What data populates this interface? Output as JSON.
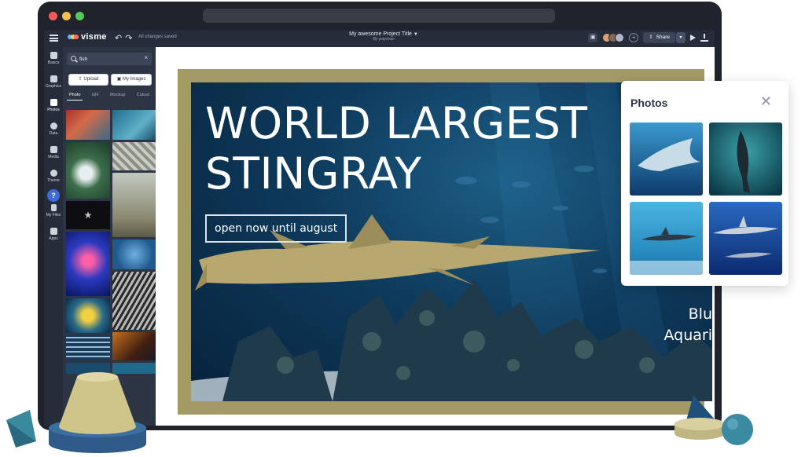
{
  "app": {
    "logo_text": "visme",
    "save_status": "All changes saved",
    "project_title": "My awesome Project Title",
    "project_byline": "By payman"
  },
  "topbar": {
    "share_label": "Share"
  },
  "rail": {
    "items": [
      {
        "label": "Basics",
        "icon": "shapes-icon"
      },
      {
        "label": "Graphics",
        "icon": "graphics-icon"
      },
      {
        "label": "Photos",
        "icon": "photo-icon"
      },
      {
        "label": "Data",
        "icon": "chart-icon"
      },
      {
        "label": "Media",
        "icon": "play-icon"
      },
      {
        "label": "Theme",
        "icon": "palette-icon"
      },
      {
        "label": "My Files",
        "icon": "file-icon"
      },
      {
        "label": "Apps",
        "icon": "apps-icon"
      }
    ],
    "help_label": "?"
  },
  "panel": {
    "search_value": "fish",
    "upload_label": "Upload",
    "my_images_label": "My Images",
    "tabs": [
      {
        "label": "Photo",
        "active": true
      },
      {
        "label": "GIF",
        "active": false
      },
      {
        "label": "Mockup",
        "active": false
      },
      {
        "label": "Cutout",
        "active": false
      }
    ]
  },
  "slide": {
    "headline_line1": "WORLD LARGEST",
    "headline_line2": "STINGRAY",
    "badge": "open now until august",
    "brand_line1": "Blu",
    "brand_line2": "Aquari"
  },
  "photos_popup": {
    "title": "Photos",
    "close_icon": "close-icon"
  },
  "colors": {
    "frame_gold": "#a39a66",
    "app_dark": "#262c3a",
    "panel_dark": "#2d3444",
    "accent_blue": "#3f6bd8"
  }
}
